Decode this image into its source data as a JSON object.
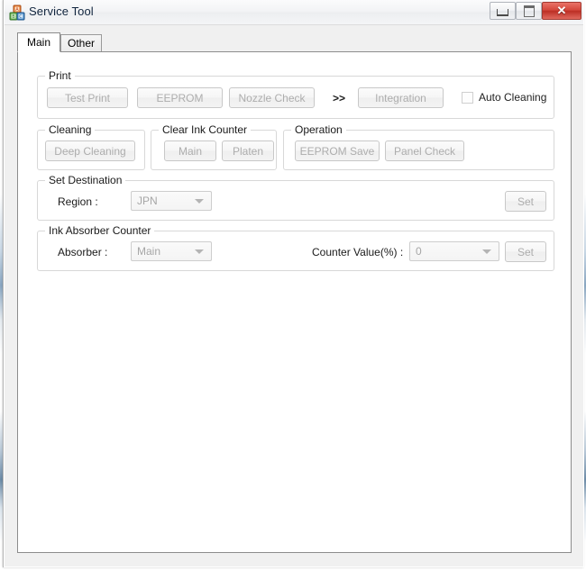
{
  "window": {
    "title": "Service Tool",
    "icon": "alphabet-blocks-icon",
    "controls": {
      "minimize": "Minimize",
      "maximize": "Maximize",
      "close": "✕"
    }
  },
  "tabs": [
    {
      "label": "Main",
      "active": true
    },
    {
      "label": "Other",
      "active": false
    }
  ],
  "groups": {
    "print": {
      "label": "Print",
      "buttons": [
        {
          "label": "Test Print",
          "enabled": false
        },
        {
          "label": "EEPROM",
          "enabled": false
        },
        {
          "label": "Nozzle Check",
          "enabled": false
        },
        {
          "label": "Integration",
          "enabled": false
        }
      ],
      "separator": ">>",
      "checkbox": {
        "label": "Auto Cleaning",
        "checked": false
      }
    },
    "cleaning": {
      "label": "Cleaning",
      "buttons": [
        {
          "label": "Deep Cleaning",
          "enabled": false
        }
      ]
    },
    "clear_ink_counter": {
      "label": "Clear Ink Counter",
      "buttons": [
        {
          "label": "Main",
          "enabled": false
        },
        {
          "label": "Platen",
          "enabled": false
        }
      ]
    },
    "operation": {
      "label": "Operation",
      "buttons": [
        {
          "label": "EEPROM Save",
          "enabled": false
        },
        {
          "label": "Panel Check",
          "enabled": false
        }
      ]
    },
    "set_destination": {
      "label": "Set Destination",
      "field_label": "Region :",
      "combo_value": "JPN",
      "set_button": "Set"
    },
    "ink_absorber_counter": {
      "label": "Ink Absorber Counter",
      "absorber_label": "Absorber :",
      "absorber_value": "Main",
      "counter_label": "Counter Value(%) :",
      "counter_value": "0",
      "set_button": "Set"
    }
  },
  "colors": {
    "title_text": "#10243d",
    "close_button": "#bc2f25",
    "disabled_text": "#adadad",
    "group_border": "#d8d8d8",
    "page_background": "#ffffff"
  }
}
